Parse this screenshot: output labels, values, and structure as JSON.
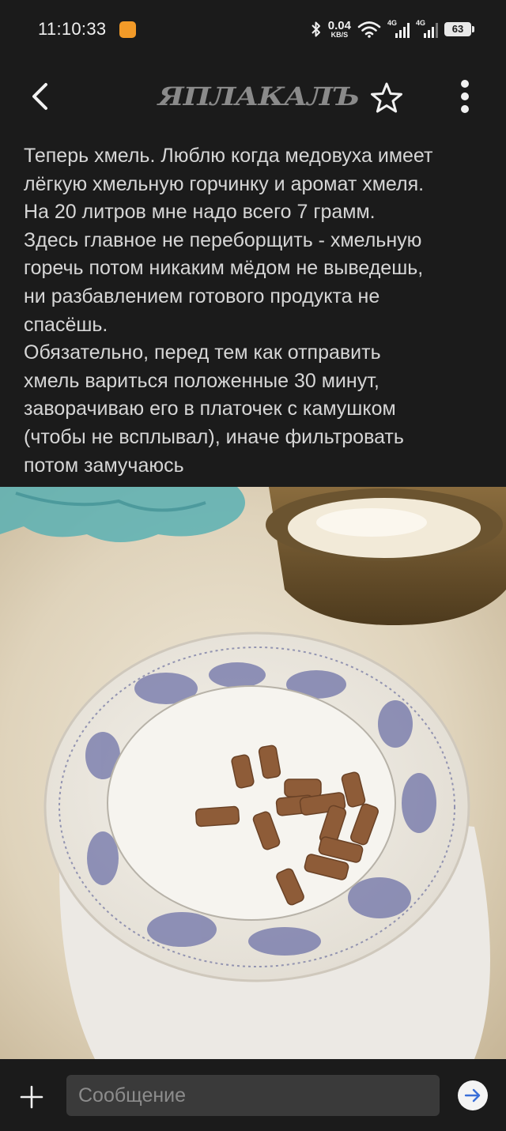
{
  "status_bar": {
    "time": "11:10:33",
    "network_speed": "0.04",
    "network_speed_unit": "KB/S",
    "signal_1_label": "4G",
    "signal_2_label": "4G",
    "battery": "63",
    "icons": [
      "app-notification-icon",
      "bluetooth-icon",
      "wifi-icon",
      "signal-icon",
      "signal-icon",
      "battery-icon"
    ]
  },
  "header": {
    "logo_text": "ЯПЛАКАЛЪ",
    "icons": [
      "back-icon",
      "star-icon",
      "more-vertical-icon"
    ]
  },
  "post": {
    "lines": [
      "Теперь хмель. Люблю когда медовуха имеет",
      "лёгкую хмельную горчинку и аромат хмеля.",
      "На 20 литров мне надо всего 7 грамм.",
      "Здесь главное не переборщить - хмельную",
      "горечь потом никаким мёдом не выведешь,",
      "ни разбавлением готового продукта не",
      "спасёшь.",
      "Обязательно, перед тем как отправить",
      "хмель вариться положенные 30 минут,",
      "заворачиваю его в платочек с камушком",
      "(чтобы не всплывал), иначе фильтровать",
      "потом замучаюсь"
    ],
    "image_icon": "photo-hop-pellets-on-plate"
  },
  "composer": {
    "placeholder": "Сообщение",
    "icons": [
      "plus-icon",
      "send-arrow-icon"
    ]
  },
  "colors": {
    "background": "#1b1b1b",
    "text": "#d6d6d6",
    "input_background": "#3a3a3a",
    "logo": "#8a8a8a"
  }
}
